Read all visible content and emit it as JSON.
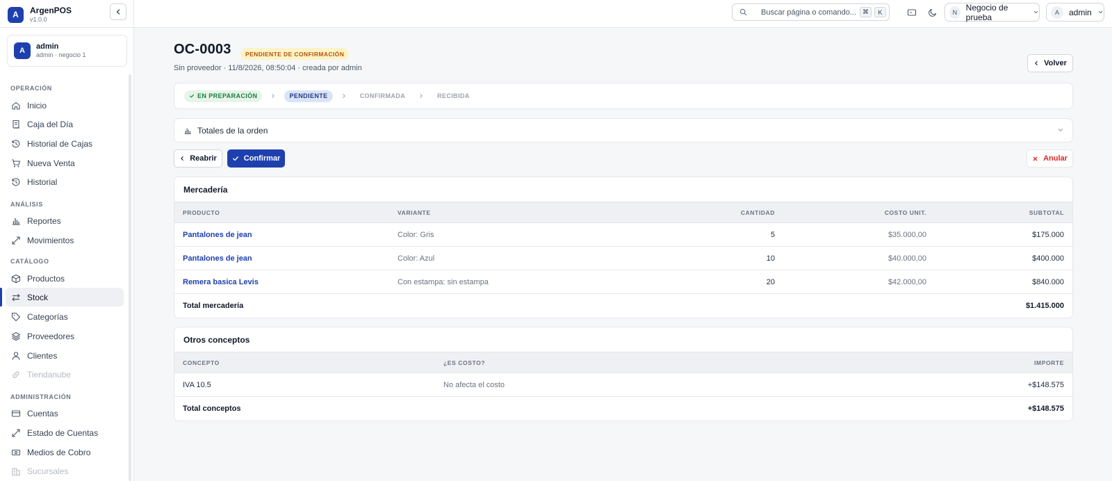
{
  "app": {
    "name": "ArgenPOS",
    "version": "v1.0.0",
    "logo_letter": "A"
  },
  "user_card": {
    "avatar": "A",
    "name": "admin",
    "subtitle": "admin · negocio 1"
  },
  "sidebar": {
    "sections": [
      {
        "title": "OPERACIÓN"
      },
      {
        "title": "ANÁLISIS"
      },
      {
        "title": "CATÁLOGO"
      },
      {
        "title": "ADMINISTRACIÓN"
      }
    ],
    "items": [
      {
        "label": "Inicio",
        "icon": "home-icon"
      },
      {
        "label": "Caja del Día",
        "icon": "receipt-icon"
      },
      {
        "label": "Historial de Cajas",
        "icon": "history-icon"
      },
      {
        "label": "Nueva Venta",
        "icon": "cart-icon"
      },
      {
        "label": "Historial",
        "icon": "history-icon"
      },
      {
        "label": "Reportes",
        "icon": "bar-chart-icon"
      },
      {
        "label": "Movimientos",
        "icon": "arrows-diagonal-icon"
      },
      {
        "label": "Productos",
        "icon": "box-icon"
      },
      {
        "label": "Stock",
        "icon": "transfer-icon",
        "active": true
      },
      {
        "label": "Categorías",
        "icon": "tag-icon"
      },
      {
        "label": "Proveedores",
        "icon": "layers-icon"
      },
      {
        "label": "Clientes",
        "icon": "user-icon"
      },
      {
        "label": "Tiendanube",
        "icon": "link-icon",
        "disabled": true
      },
      {
        "label": "Cuentas",
        "icon": "card-icon"
      },
      {
        "label": "Estado de Cuentas",
        "icon": "arrows-diagonal-icon"
      },
      {
        "label": "Medios de Cobro",
        "icon": "banknote-icon"
      },
      {
        "label": "Sucursales",
        "icon": "building-icon",
        "disabled": true
      }
    ]
  },
  "topbar": {
    "search_placeholder": "Buscar página o comando...",
    "shortcut_key_1": "⌘",
    "shortcut_key_2": "K",
    "business": {
      "avatar": "N",
      "name": "Negocio de prueba"
    },
    "account": {
      "avatar": "A",
      "name": "admin"
    }
  },
  "order": {
    "code": "OC-0003",
    "status_badge": "PENDIENTE DE CONFIRMACIÓN",
    "subtitle": "Sin proveedor · 11/8/2026, 08:50:04 · creada por admin",
    "back_label": "Volver",
    "steps": [
      {
        "label": "EN PREPARACIÓN",
        "state": "done"
      },
      {
        "label": "PENDIENTE",
        "state": "current"
      },
      {
        "label": "CONFIRMADA",
        "state": "future"
      },
      {
        "label": "RECIBIDA",
        "state": "future"
      }
    ],
    "totals_label": "Totales de la orden",
    "actions": {
      "reopen": "Reabrir",
      "confirm": "Confirmar",
      "cancel": "Anular"
    }
  },
  "merchandise": {
    "title": "Mercadería",
    "columns": [
      "PRODUCTO",
      "VARIANTE",
      "CANTIDAD",
      "COSTO UNIT.",
      "SUBTOTAL"
    ],
    "rows": [
      {
        "product": "Pantalones de jean",
        "variant": "Color: Gris",
        "qty": "5",
        "unit_cost": "$35.000,00",
        "subtotal": "$175.000"
      },
      {
        "product": "Pantalones de jean",
        "variant": "Color: Azul",
        "qty": "10",
        "unit_cost": "$40.000,00",
        "subtotal": "$400.000"
      },
      {
        "product": "Remera basica Levis",
        "variant": "Con estampa: sin estampa",
        "qty": "20",
        "unit_cost": "$42.000,00",
        "subtotal": "$840.000"
      }
    ],
    "total_label": "Total mercadería",
    "total_value": "$1.415.000"
  },
  "other_concepts": {
    "title": "Otros conceptos",
    "columns": [
      "CONCEPTO",
      "¿ES COSTO?",
      "IMPORTE"
    ],
    "rows": [
      {
        "concept": "IVA 10.5",
        "is_cost": "No afecta el costo",
        "amount": "+$148.575"
      }
    ],
    "total_label": "Total conceptos",
    "total_value": "+$148.575"
  }
}
